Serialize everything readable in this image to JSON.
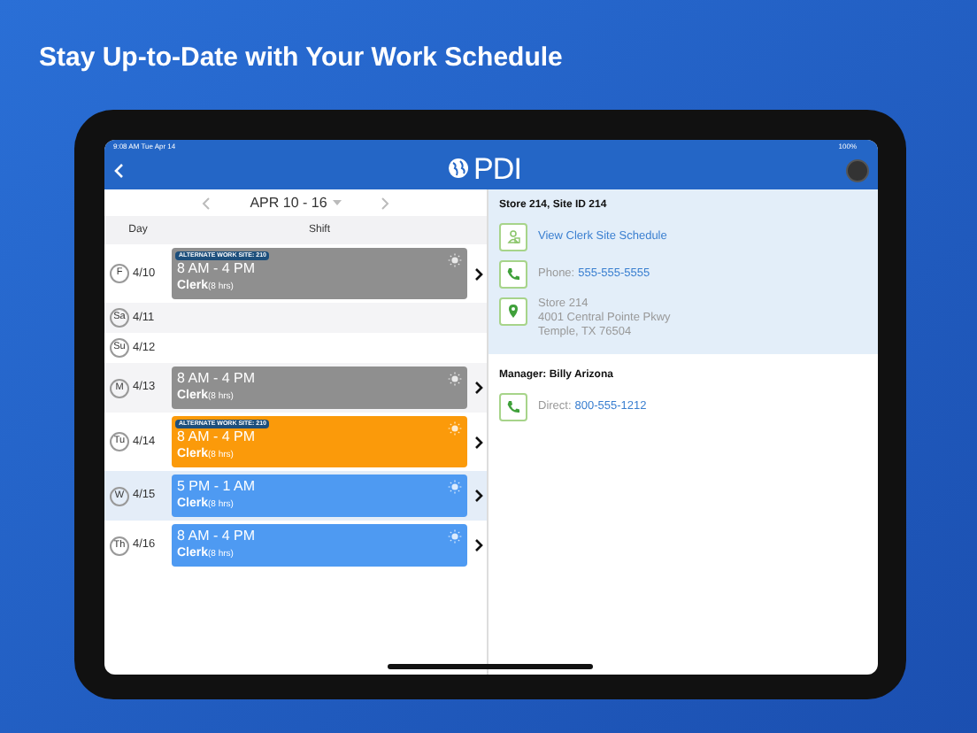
{
  "headline": "Stay Up-to-Date with Your Work Schedule",
  "status_bar": {
    "time": "9:08 AM",
    "date": "Tue Apr 14",
    "battery": "100%"
  },
  "header": {
    "logo": "PDI"
  },
  "week": {
    "label": "APR 10 - 16"
  },
  "columns": [
    "Day",
    "Shift"
  ],
  "days": [
    {
      "day": "F",
      "date": "4/10",
      "selected": false,
      "shift": {
        "kind": "past",
        "badge": "ALTERNATE WORK SITE: 210",
        "time": "8 AM - 4 PM",
        "role": "Clerk",
        "hours": "(8 hrs)"
      }
    },
    {
      "day": "Sa",
      "date": "4/11",
      "selected": false
    },
    {
      "day": "Su",
      "date": "4/12",
      "selected": false
    },
    {
      "day": "M",
      "date": "4/13",
      "selected": false,
      "shift": {
        "kind": "past",
        "time": "8 AM - 4 PM",
        "role": "Clerk",
        "hours": "(8 hrs)"
      }
    },
    {
      "day": "Tu",
      "date": "4/14",
      "selected": false,
      "shift": {
        "kind": "alternate",
        "badge": "ALTERNATE WORK SITE: 210",
        "time": "8 AM - 4 PM",
        "role": "Clerk",
        "hours": "(8 hrs)"
      }
    },
    {
      "day": "W",
      "date": "4/15",
      "selected": true,
      "shift": {
        "kind": "scheduled",
        "time": "5 PM - 1 AM",
        "role": "Clerk",
        "hours": "(8 hrs)"
      }
    },
    {
      "day": "Th",
      "date": "4/16",
      "selected": false,
      "shift": {
        "kind": "scheduled",
        "time": "8 AM - 4 PM",
        "role": "Clerk",
        "hours": "(8 hrs)"
      }
    }
  ],
  "site": {
    "title": "Store 214, Site ID 214",
    "items": [
      {
        "kind": "schedule",
        "text": "View Clerk Site Schedule"
      },
      {
        "kind": "phone",
        "label": "Phone:",
        "number": "555-555-5555"
      },
      {
        "kind": "address",
        "lines": [
          "Store 214",
          "4001 Central Pointe Pkwy",
          "Temple, TX 76504"
        ]
      }
    ]
  },
  "manager": {
    "title": "Manager: Billy Arizona",
    "items": [
      {
        "kind": "phone",
        "label": "Direct:",
        "number": "800-555-1212"
      }
    ]
  }
}
